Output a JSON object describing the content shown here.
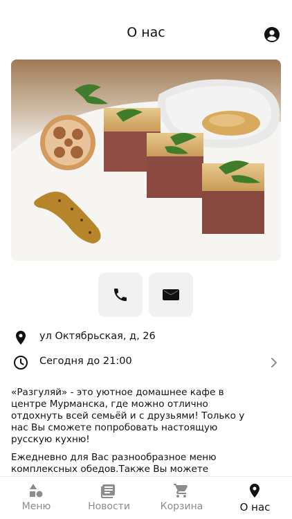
{
  "header": {
    "title": "О нас"
  },
  "icons": {
    "profile": "account-circle-icon",
    "phone": "phone-icon",
    "mail": "mail-icon",
    "location": "location-pin-icon",
    "clock": "clock-icon",
    "chevron": "chevron-right-icon"
  },
  "contacts": {
    "address": "ул Октябрьская, д, 26",
    "hours": "Сегодня до 21:00"
  },
  "description": {
    "paragraph1": "«Разгуляй» - это уютное домашнее кафе в центре Мурманска, где можно отлично отдохнуть всей семьёй и с друзьями! Только у нас Вы сможете попробовать настоящую русскую кухню!",
    "paragraph2": "Ежедневно для Вас разнообразное меню комплексных обедов.Также Вы можете заказать"
  },
  "tabbar": {
    "menu": "Меню",
    "news": "Новости",
    "cart": "Корзина",
    "about": "О нас"
  },
  "colors": {
    "active": "#111111",
    "inactive": "#8c8c8c",
    "button_bg": "#f1f1f1"
  }
}
